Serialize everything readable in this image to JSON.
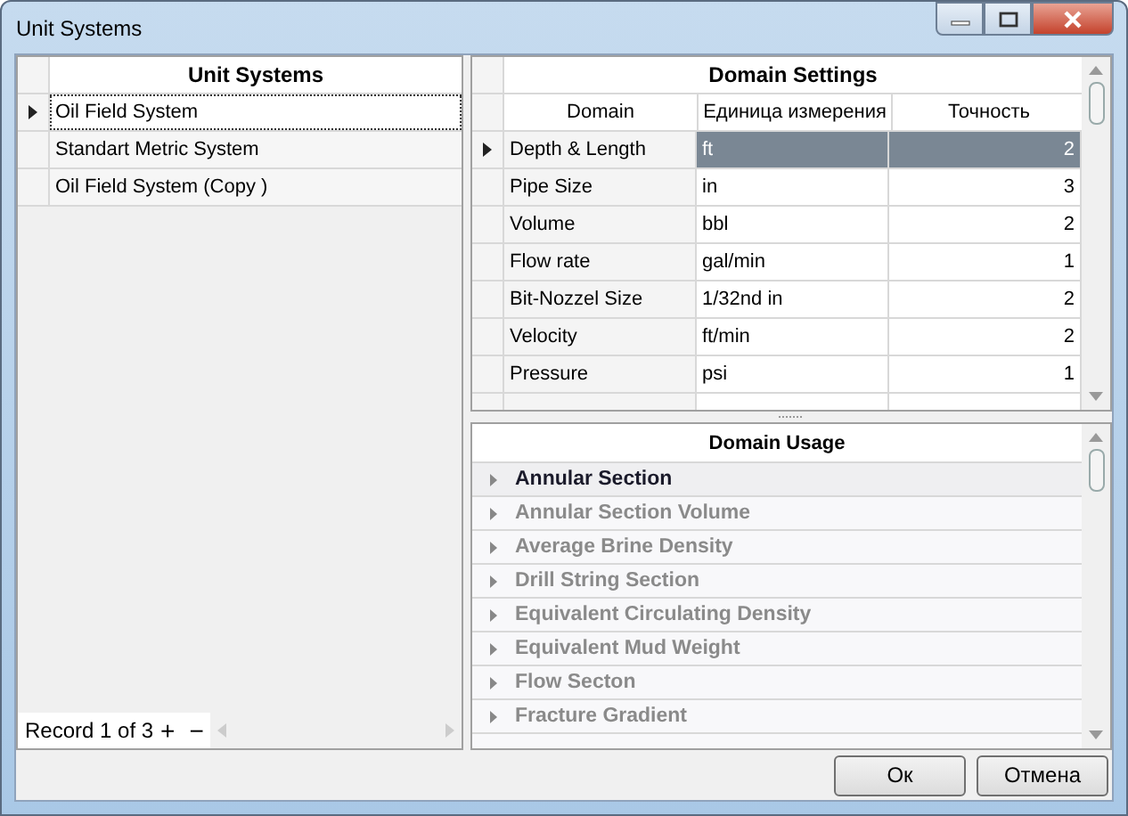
{
  "window": {
    "title": "Unit Systems"
  },
  "unit_systems": {
    "header": "Unit Systems",
    "rows": [
      {
        "name": "Oil Field System",
        "selected": true
      },
      {
        "name": "Standart Metric System",
        "selected": false
      },
      {
        "name": "Oil Field System (Copy )",
        "selected": false
      }
    ],
    "navigator": {
      "record": "Record 1 of 3",
      "add": "+",
      "remove": "−"
    }
  },
  "domain_settings": {
    "title": "Domain Settings",
    "columns": [
      "Domain",
      "Единица измерения",
      "Точность"
    ],
    "rows": [
      {
        "domain": "Depth & Length",
        "unit": "ft",
        "precision": "2",
        "selected": true
      },
      {
        "domain": "Pipe Size",
        "unit": "in",
        "precision": "3",
        "selected": false
      },
      {
        "domain": "Volume",
        "unit": "bbl",
        "precision": "2",
        "selected": false
      },
      {
        "domain": "Flow rate",
        "unit": "gal/min",
        "precision": "1",
        "selected": false
      },
      {
        "domain": "Bit-Nozzel Size",
        "unit": "1/32nd in",
        "precision": "2",
        "selected": false
      },
      {
        "domain": "Velocity",
        "unit": "ft/min",
        "precision": "2",
        "selected": false
      },
      {
        "domain": "Pressure",
        "unit": "psi",
        "precision": "1",
        "selected": false
      }
    ]
  },
  "domain_usage": {
    "title": "Domain Usage",
    "items": [
      {
        "label": "Annular Section",
        "selected": true
      },
      {
        "label": "Annular Section Volume",
        "selected": false
      },
      {
        "label": "Average Brine Density",
        "selected": false
      },
      {
        "label": "Drill String Section",
        "selected": false
      },
      {
        "label": "Equivalent Circulating Density",
        "selected": false
      },
      {
        "label": "Equivalent Mud Weight",
        "selected": false
      },
      {
        "label": "Flow Secton",
        "selected": false
      },
      {
        "label": "Fracture Gradient",
        "selected": false
      }
    ]
  },
  "buttons": [
    "Ок",
    "Отмена"
  ]
}
